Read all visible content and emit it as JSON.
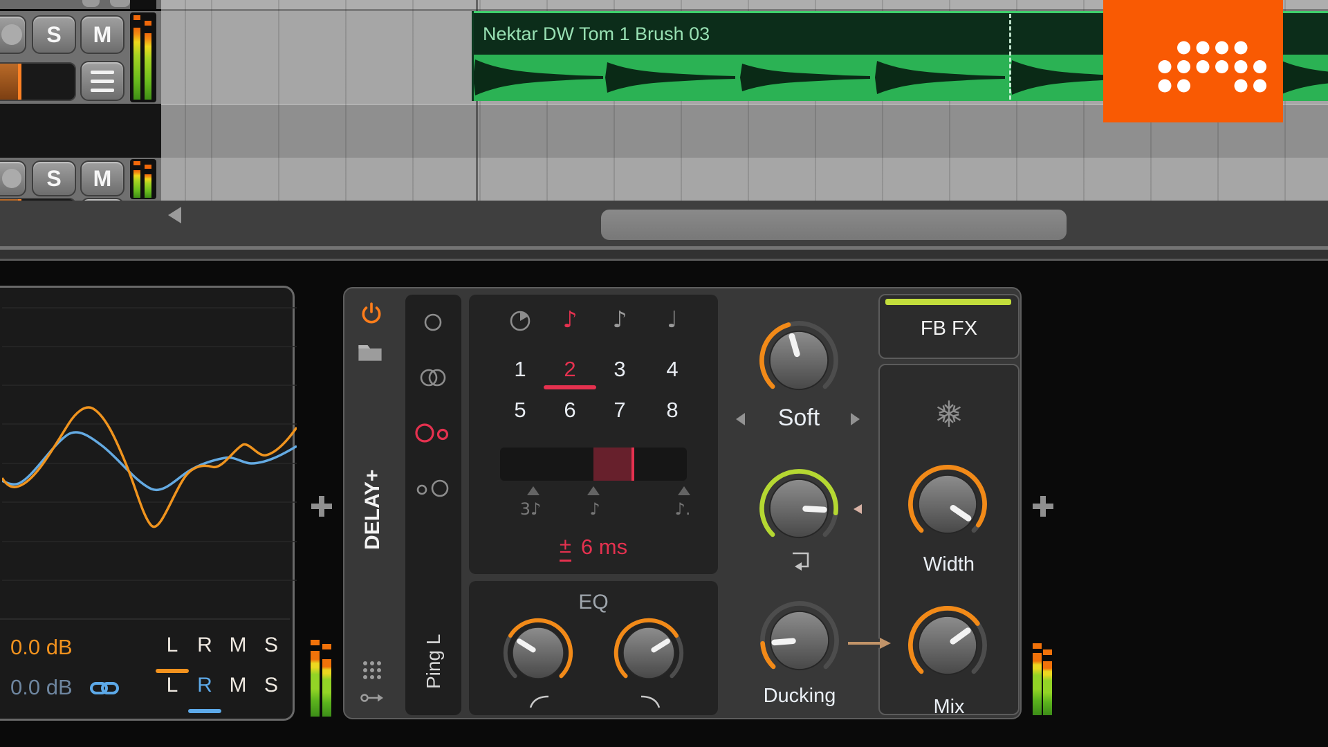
{
  "tracks": {
    "track1": {
      "solo_label": "S",
      "mute_label": "M"
    },
    "track2": {
      "solo_label": "S",
      "mute_label": "M"
    }
  },
  "clip": {
    "title": "Nektar DW Tom 1 Brush 03"
  },
  "device": {
    "title": "DELAY+",
    "mode_label": "Ping L",
    "sync": {
      "steps": [
        "1",
        "2",
        "3",
        "4",
        "5",
        "6",
        "7",
        "8"
      ],
      "selected_step": "2",
      "note_icons": [
        "♪",
        "♪",
        "♩"
      ],
      "grid_note_icons": [
        "3♪",
        "♪",
        "♪."
      ],
      "offset_sign": "±",
      "offset_value": "6 ms"
    },
    "eq_label": "EQ",
    "shaper_value": "Soft",
    "ducking_label": "Ducking",
    "fbfx": {
      "title": "FB FX",
      "width_label": "Width",
      "mix_label": "Mix"
    }
  },
  "scope": {
    "row1": {
      "gain": "0.0 dB",
      "channels": [
        "L",
        "R",
        "M",
        "S"
      ],
      "selected": "L"
    },
    "row2": {
      "gain": "0.0 dB",
      "channels": [
        "L",
        "R",
        "M",
        "S"
      ],
      "selected": "R"
    }
  },
  "colors": {
    "accent_orange": "#f28a18",
    "accent_red": "#e5314f",
    "accent_lime": "#b5d832",
    "accent_blue": "#5da9e8",
    "clip_green": "#2bb254",
    "logo_orange": "#f95a03"
  }
}
